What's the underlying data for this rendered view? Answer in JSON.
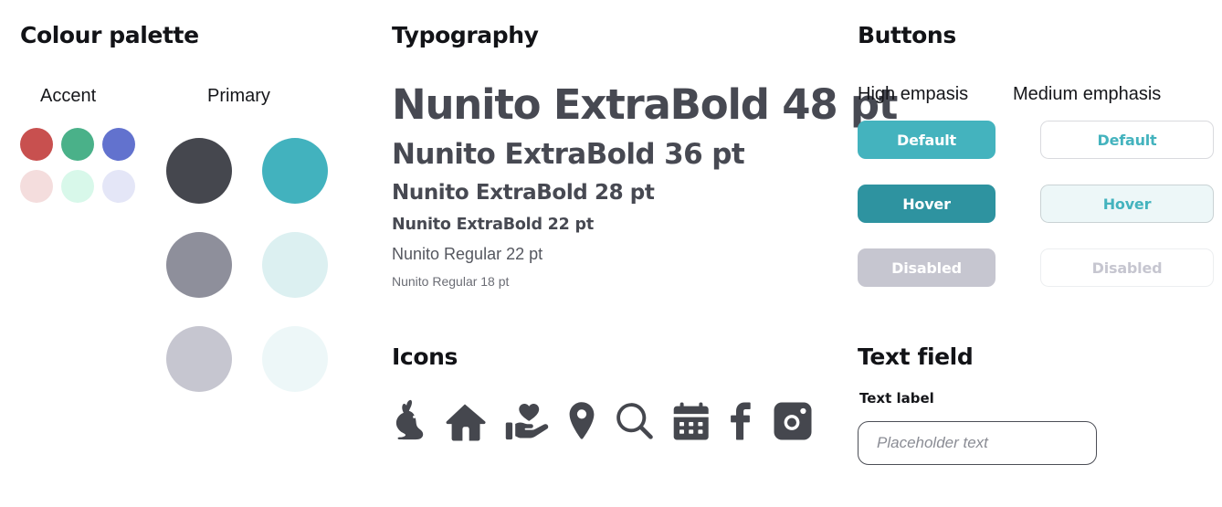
{
  "palette": {
    "title": "Colour palette",
    "groups": [
      {
        "name": "Accent",
        "label": "Accent",
        "swatches": [
          {
            "name": "accent-red",
            "hex": "#C8504F"
          },
          {
            "name": "accent-green",
            "hex": "#4AB189"
          },
          {
            "name": "accent-blue",
            "hex": "#6272CE"
          },
          {
            "name": "accent-red-light",
            "hex": "#F4DDDD"
          },
          {
            "name": "accent-green-light",
            "hex": "#D8F8EA"
          },
          {
            "name": "accent-blue-light",
            "hex": "#E4E6F7"
          }
        ]
      },
      {
        "name": "Primary",
        "label": "Primary",
        "swatches": [
          {
            "name": "primary-dark-grey",
            "hex": "#45474E"
          },
          {
            "name": "primary-teal",
            "hex": "#42B2BE"
          },
          {
            "name": "primary-mid-grey",
            "hex": "#8E8F9B"
          },
          {
            "name": "primary-teal-light",
            "hex": "#DCF0F1"
          },
          {
            "name": "primary-light-grey",
            "hex": "#C6C6D0"
          },
          {
            "name": "primary-teal-lightest",
            "hex": "#EDF7F8"
          }
        ]
      }
    ]
  },
  "typography": {
    "title": "Typography",
    "specimens": [
      {
        "name": "type-48",
        "text": "Nunito ExtraBold 48 pt"
      },
      {
        "name": "type-36",
        "text": "Nunito ExtraBold 36 pt"
      },
      {
        "name": "type-28",
        "text": "Nunito ExtraBold 28 pt"
      },
      {
        "name": "type-22-bold",
        "text": "Nunito ExtraBold 22 pt"
      },
      {
        "name": "type-22-regular",
        "text": "Nunito Regular 22 pt"
      },
      {
        "name": "type-18-regular",
        "text": "Nunito Regular 18 pt"
      }
    ]
  },
  "icons": {
    "title": "Icons",
    "colour": "#45474E",
    "items": [
      {
        "name": "rabbit-icon",
        "label": "rabbit"
      },
      {
        "name": "home-icon",
        "label": "home"
      },
      {
        "name": "hand-heart-icon",
        "label": "hand-heart"
      },
      {
        "name": "location-pin-icon",
        "label": "location pin"
      },
      {
        "name": "search-icon",
        "label": "search"
      },
      {
        "name": "calendar-icon",
        "label": "calendar"
      },
      {
        "name": "facebook-icon",
        "label": "facebook"
      },
      {
        "name": "instagram-icon",
        "label": "instagram"
      }
    ]
  },
  "buttons": {
    "title": "Buttons",
    "columns": [
      {
        "name": "high-emphasis",
        "label": "High empasis",
        "items": [
          {
            "name": "high-default",
            "label": "Default",
            "fill": "#44B3BE",
            "text": "#FFFFFF"
          },
          {
            "name": "high-hover",
            "label": "Hover",
            "fill": "#2E93A0",
            "text": "#FFFFFF"
          },
          {
            "name": "high-disabled",
            "label": "Disabled",
            "fill": "#C6C6D0",
            "text": "#FFFFFF"
          }
        ]
      },
      {
        "name": "medium-emphasis",
        "label": "Medium emphasis",
        "items": [
          {
            "name": "medium-default",
            "label": "Default",
            "fill": "#FFFFFF",
            "text": "#44B3BE"
          },
          {
            "name": "medium-hover",
            "label": "Hover",
            "fill": "#EDF7F8",
            "text": "#44B3BE"
          },
          {
            "name": "medium-disabled",
            "label": "Disabled",
            "fill": "#FFFFFF",
            "text": "#C6C6D0"
          }
        ]
      }
    ]
  },
  "textfield": {
    "title": "Text field",
    "label": "Text label",
    "placeholder": "Placeholder text",
    "value": ""
  }
}
